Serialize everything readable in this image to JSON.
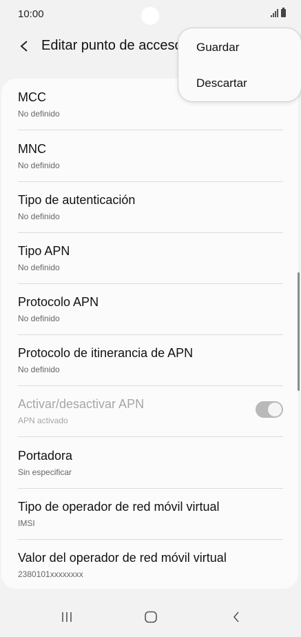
{
  "status_bar": {
    "time": "10:00",
    "icons": [
      "signal-icon",
      "battery-icon"
    ]
  },
  "app_bar": {
    "title": "Editar punto de acceso",
    "back_icon": "chevron-left-icon"
  },
  "menu": {
    "items": [
      {
        "label": "Guardar"
      },
      {
        "label": "Descartar"
      }
    ]
  },
  "settings": {
    "items": [
      {
        "title": "MCC",
        "value": "No definido"
      },
      {
        "title": "MNC",
        "value": "No definido"
      },
      {
        "title": "Tipo de autenticación",
        "value": "No definido"
      },
      {
        "title": "Tipo APN",
        "value": "No definido"
      },
      {
        "title": "Protocolo APN",
        "value": "No definido"
      },
      {
        "title": "Protocolo de itinerancia de APN",
        "value": "No definido"
      },
      {
        "title": "Activar/desactivar APN",
        "value": "APN activado",
        "toggle_on": true,
        "disabled": true
      },
      {
        "title": "Portadora",
        "value": "Sin especificar"
      },
      {
        "title": "Tipo de operador de red móvil virtual",
        "value": "IMSI"
      },
      {
        "title": "Valor del operador de red móvil virtual",
        "value": "2380101xxxxxxxx"
      }
    ]
  },
  "nav_bar": {
    "icons": [
      "recents-icon",
      "home-icon",
      "back-icon"
    ]
  }
}
